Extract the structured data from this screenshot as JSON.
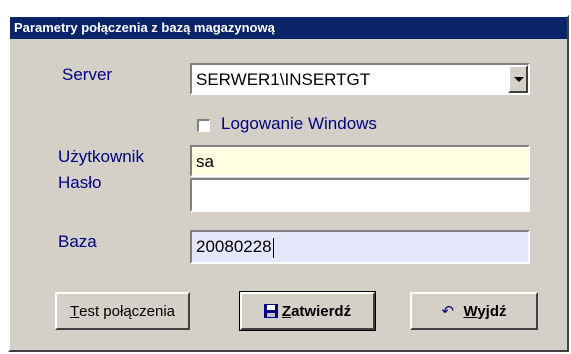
{
  "dialog": {
    "title": "Parametry połączenia z bazą magazynową"
  },
  "form": {
    "server_label": "Server",
    "server_value": "SERWER1\\INSERTGT",
    "windows_login_label": "Logowanie Windows",
    "windows_login_checked": false,
    "user_label": "Użytkownik",
    "user_value": "sa",
    "password_label": "Hasło",
    "password_value": "",
    "database_label": "Baza",
    "database_value": "20080228"
  },
  "buttons": {
    "test_first": "T",
    "test_rest": "est połączenia",
    "confirm_first": "Z",
    "confirm_rest": "atwierdź",
    "exit_first": "W",
    "exit_rest": "yjdź"
  },
  "colors": {
    "dialog_bg": "#d4d0c8",
    "titlebar_bg": "#0a246a",
    "label_text": "#000080",
    "user_field_bg": "#ffffe1",
    "database_field_bg": "#e6e6fa"
  },
  "icons": {
    "confirm": "floppy-disk-icon",
    "exit": "undo-arrow-icon",
    "combo": "chevron-down-icon"
  }
}
